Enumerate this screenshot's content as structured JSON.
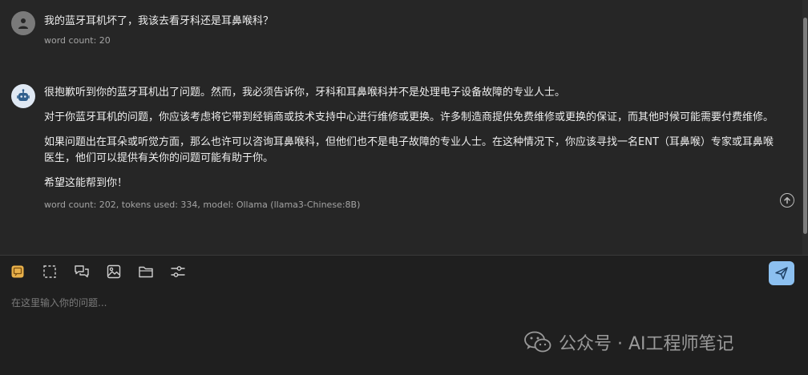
{
  "messages": [
    {
      "role": "user",
      "avatar_icon": "user-icon",
      "text": "我的蓝牙耳机坏了，我该去看牙科还是耳鼻喉科？",
      "meta": "word count: 20"
    },
    {
      "role": "assistant",
      "avatar_icon": "robot-icon",
      "paragraphs": [
        "很抱歉听到你的蓝牙耳机出了问题。然而，我必须告诉你，牙科和耳鼻喉科并不是处理电子设备故障的专业人士。",
        "对于你蓝牙耳机的问题，你应该考虑将它带到经销商或技术支持中心进行维修或更换。许多制造商提供免费维修或更换的保证，而其他时候可能需要付费维修。",
        "如果问题出在耳朵或听觉方面，那么也许可以咨询耳鼻喉科，但他们也不是电子故障的专业人士。在这种情况下，你应该寻找一名ENT（耳鼻喉）专家或耳鼻喉医生，他们可以提供有关你的问题可能有助于你。",
        "希望这能帮到你！"
      ],
      "meta": "word count: 202, tokens used: 334, model: Ollama (llama3-Chinese:8B)"
    }
  ],
  "composer": {
    "placeholder": "在这里输入你的问题...",
    "tools": [
      "note-icon",
      "selection-icon",
      "chat-bubbles-icon",
      "image-icon",
      "folder-icon",
      "sliders-icon"
    ],
    "send_icon": "send-icon"
  },
  "watermark": {
    "text": "公众号 · AI工程师笔记"
  },
  "colors": {
    "background": "#262626",
    "composer_bg": "#1f1f1f",
    "send_button": "#8cc0f0",
    "note_icon": "#e8b04a"
  }
}
